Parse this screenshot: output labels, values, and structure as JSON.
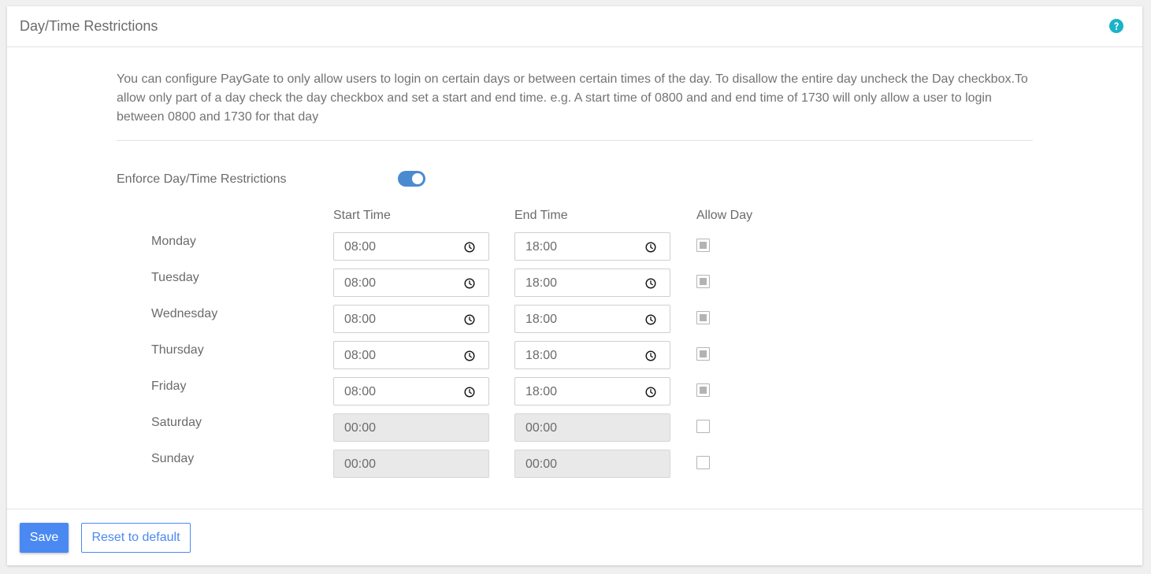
{
  "header": {
    "title": "Day/Time Restrictions",
    "help_icon": "help-circle-icon",
    "help_color": "#1ab3c7"
  },
  "description": "You can configure PayGate to only allow users to login on certain days or between certain times of the day. To disallow the entire day uncheck the Day checkbox.To allow only part of a day check the day checkbox and set a start and end time. e.g. A start time of 0800 and and end time of 1730 will only allow a user to login between 0800 and 1730 for that day",
  "enforce": {
    "label": "Enforce Day/Time Restrictions",
    "enabled": true,
    "color": "#4a8ad1"
  },
  "columns": {
    "start": "Start Time",
    "end": "End Time",
    "allow": "Allow Day"
  },
  "days": [
    {
      "name": "Monday",
      "start": "08:00",
      "end": "18:00",
      "allowed": true
    },
    {
      "name": "Tuesday",
      "start": "08:00",
      "end": "18:00",
      "allowed": true
    },
    {
      "name": "Wednesday",
      "start": "08:00",
      "end": "18:00",
      "allowed": true
    },
    {
      "name": "Thursday",
      "start": "08:00",
      "end": "18:00",
      "allowed": true
    },
    {
      "name": "Friday",
      "start": "08:00",
      "end": "18:00",
      "allowed": true
    },
    {
      "name": "Saturday",
      "start": "00:00",
      "end": "00:00",
      "allowed": false
    },
    {
      "name": "Sunday",
      "start": "00:00",
      "end": "00:00",
      "allowed": false
    }
  ],
  "footer": {
    "save_label": "Save",
    "reset_label": "Reset to default",
    "primary_color": "#4a89f2"
  }
}
